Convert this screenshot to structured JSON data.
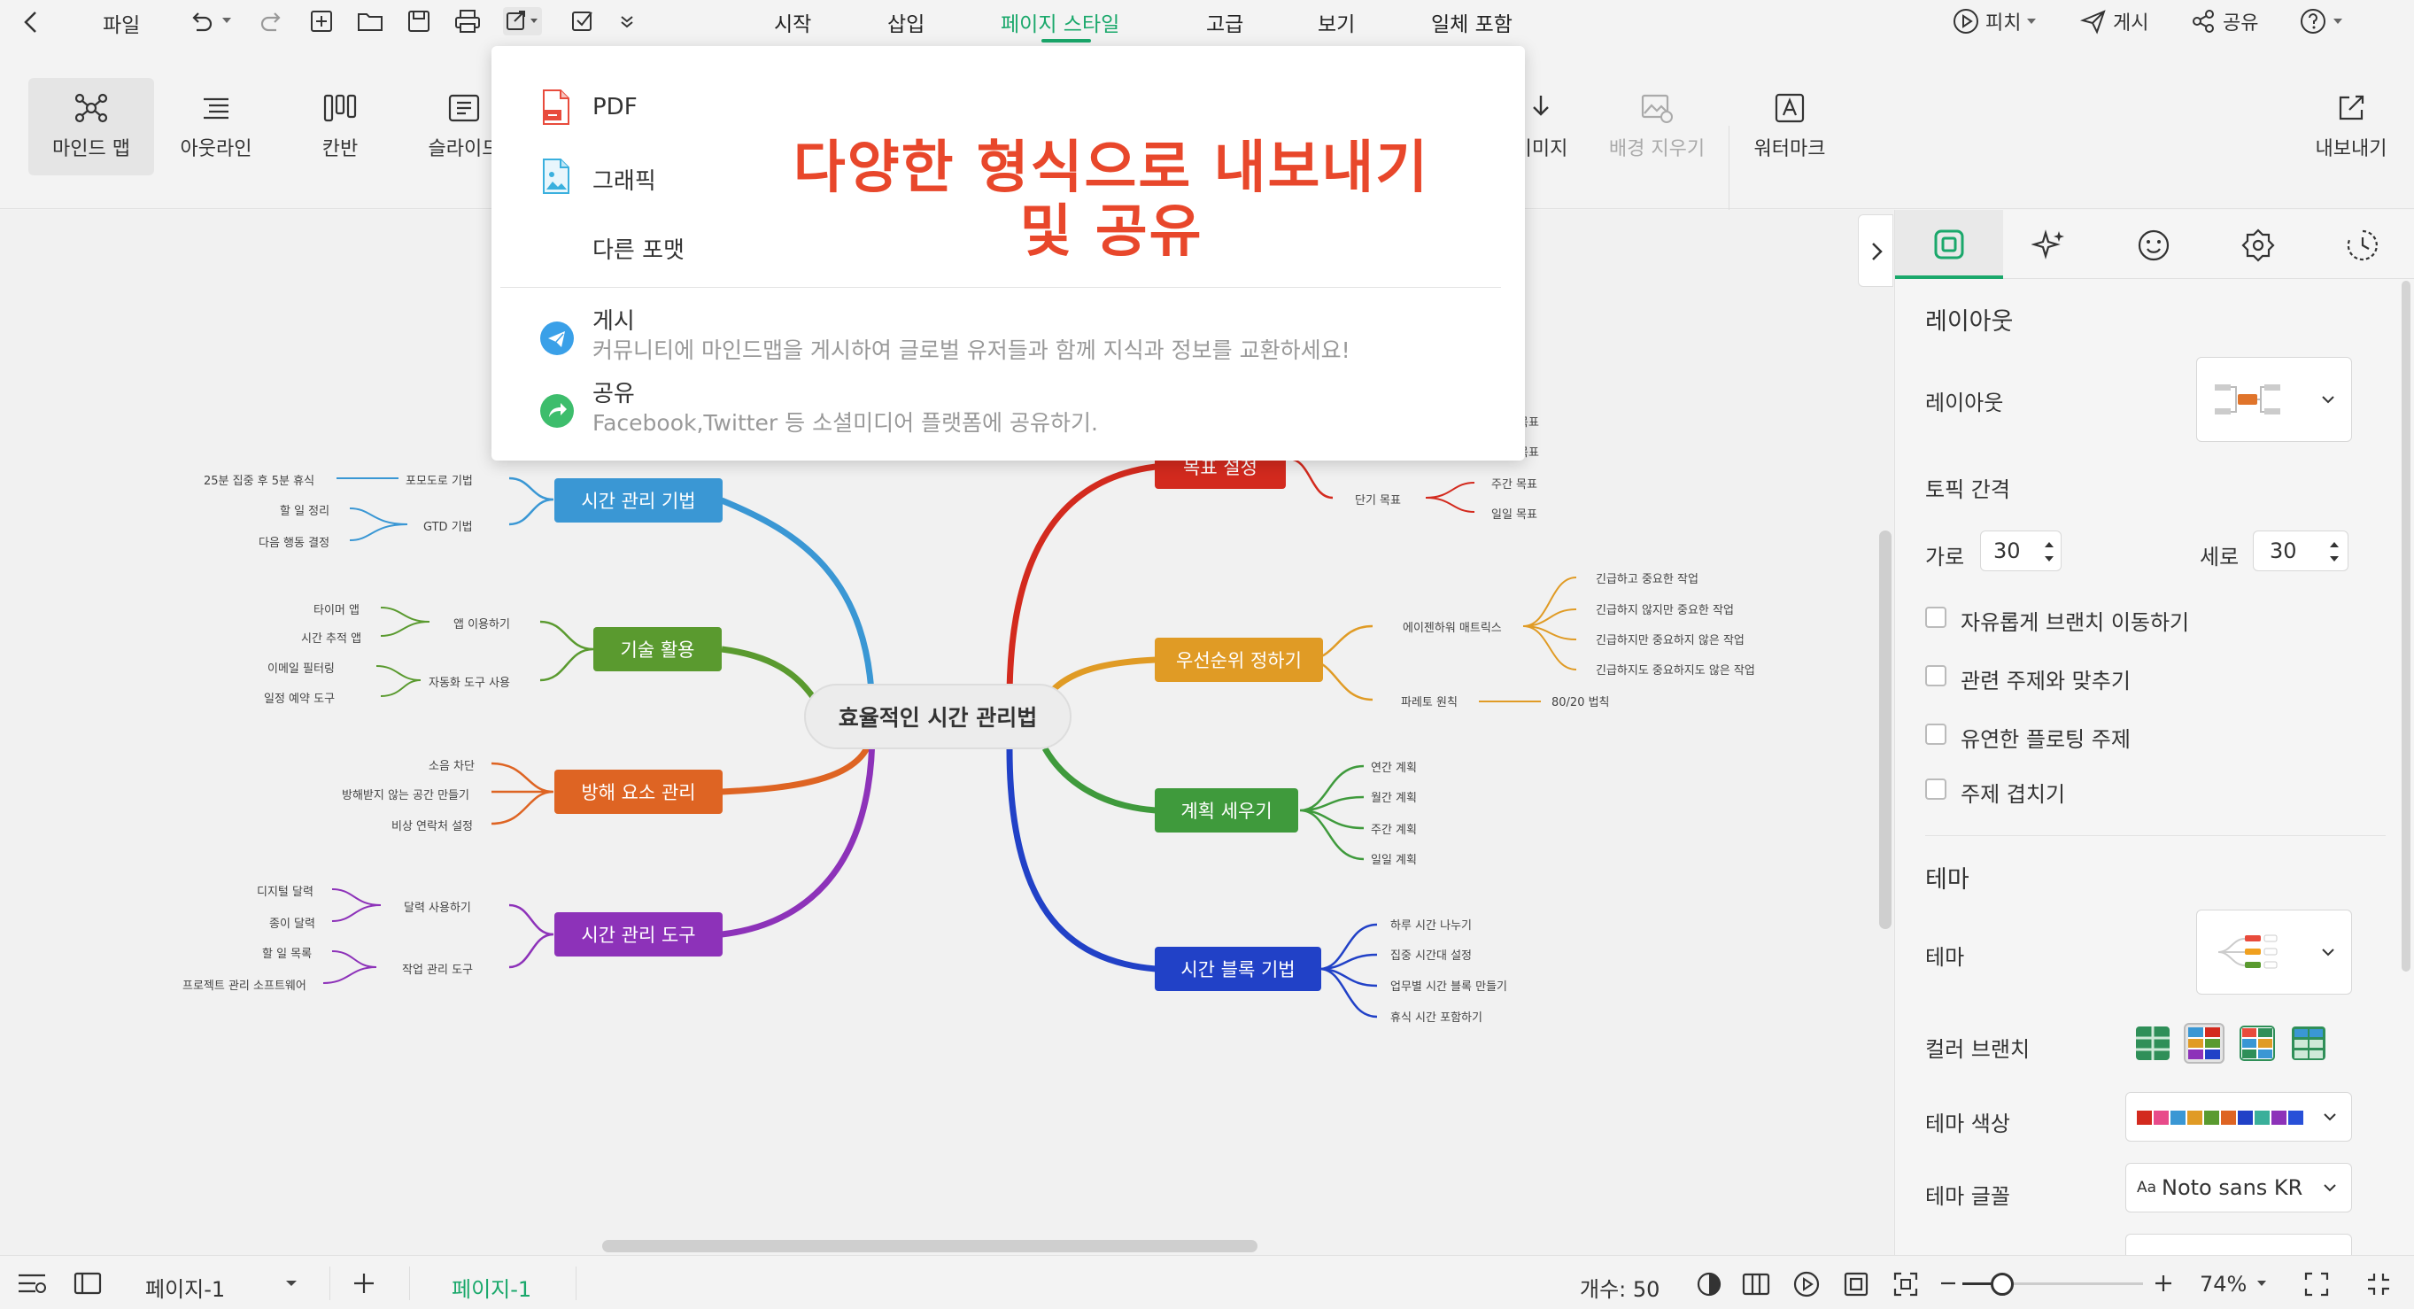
{
  "topbar": {
    "file_label": "파일",
    "tabs": [
      {
        "label": "시작"
      },
      {
        "label": "삽입"
      },
      {
        "label": "페이지 스타일"
      },
      {
        "label": "고급"
      },
      {
        "label": "보기"
      },
      {
        "label": "일체 포함"
      }
    ],
    "active_tab_color": "#1aa86b",
    "pitch_label": "피치",
    "publish_label": "게시",
    "share_label": "공유"
  },
  "toolbar": {
    "items": [
      {
        "label": "마인드 맵"
      },
      {
        "label": "아웃라인"
      },
      {
        "label": "칸반"
      },
      {
        "label": "슬라이드"
      }
    ],
    "image_label": "이미지",
    "remove_bg_label": "배경 지우기",
    "watermark_label": "워터마크",
    "export_label": "내보내기"
  },
  "export_menu": {
    "pdf": "PDF",
    "graphic": "그래픽",
    "other_format": "다른 포맷",
    "publish_title": "게시",
    "publish_desc": "커뮤니티에 마인드맵을 게시하여 글로벌 유저들과 함께 지식과 정보를 교환하세요!",
    "share_title": "공유",
    "share_desc": "Facebook,Twitter 등 소셜미디어 플랫폼에 공유하기.",
    "promo_line1": "다양한 형식으로 내보내기",
    "promo_line2": "및 공유",
    "promo_color": "#e8472b"
  },
  "mindmap": {
    "center": "효율적인 시간 관리법",
    "branches": {
      "b1": {
        "label": "시간 관리 기법",
        "color": "#3a97d4",
        "subs": [
          "포모도로 기법",
          "GTD 기법"
        ],
        "leaves": [
          "25분 집중 후 5분 휴식",
          "할 일 정리",
          "다음 행동 결정"
        ]
      },
      "b2": {
        "label": "기술 활용",
        "color": "#5a9a2f",
        "subs": [
          "앱 이용하기",
          "자동화 도구 사용"
        ],
        "leaves": [
          "타이머 앱",
          "시간 추적 앱",
          "이메일 필터링",
          "일정 예약 도구"
        ]
      },
      "b3": {
        "label": "방해 요소 관리",
        "color": "#de6423",
        "leaves": [
          "소음 차단",
          "방해받지 않는 공간 만들기",
          "비상 연락처 설정"
        ]
      },
      "b4": {
        "label": "시간 관리 도구",
        "color": "#8d32b9",
        "subs": [
          "달력 사용하기",
          "작업 관리 도구"
        ],
        "leaves": [
          "디지털 달력",
          "종이 달력",
          "할 일 목록",
          "프로젝트 관리 소프트웨어"
        ]
      },
      "r1": {
        "label": "목표 설정",
        "color": "#d32a1e",
        "subs": [
          "단기 목표"
        ],
        "leaves": [
          "목표",
          "목표",
          "주간 목표",
          "일일 목표"
        ]
      },
      "r2": {
        "label": "우선순위 정하기",
        "color": "#e09b25",
        "subs": [
          "에이젠하워 매트릭스",
          "파레토 원칙"
        ],
        "leaves": [
          "긴급하고 중요한 작업",
          "긴급하지 않지만 중요한 작업",
          "긴급하지만 중요하지 않은 작업",
          "긴급하지도 중요하지도 않은 작업",
          "80/20 법칙"
        ]
      },
      "r3": {
        "label": "계획 세우기",
        "color": "#3f9a3c",
        "leaves": [
          "연간 계획",
          "월간 계획",
          "주간 계획",
          "일일 계획"
        ]
      },
      "r4": {
        "label": "시간 블록 기법",
        "color": "#2141c7",
        "leaves": [
          "하루 시간 나누기",
          "집중 시간대 설정",
          "업무별 시간 블록 만들기",
          "휴식 시간 포함하기"
        ]
      }
    }
  },
  "right_panel": {
    "layout_section": "레이아웃",
    "layout_label": "레이아웃",
    "topic_spacing": "토픽 간격",
    "horizontal_label": "가로",
    "horizontal_value": "30",
    "vertical_label": "세로",
    "vertical_value": "30",
    "checkboxes": [
      "자유롭게 브랜치 이동하기",
      "관련 주제와 맞추기",
      "유연한 플로팅 주제",
      "주제 겹치기"
    ],
    "theme_section": "테마",
    "theme_label": "테마",
    "color_branch_label": "컬러 브랜치",
    "theme_color_label": "테마 색상",
    "theme_font_label": "테마 글꼴",
    "theme_font_value": "Noto sans KR",
    "theme_font_prefix": "Aa",
    "accent_color": "#1aa86b"
  },
  "statusbar": {
    "page_select": "페이지-1",
    "active_page": "페이지-1",
    "count": "개수: 50",
    "zoom": "74%",
    "zoom_fraction": 0.74
  }
}
